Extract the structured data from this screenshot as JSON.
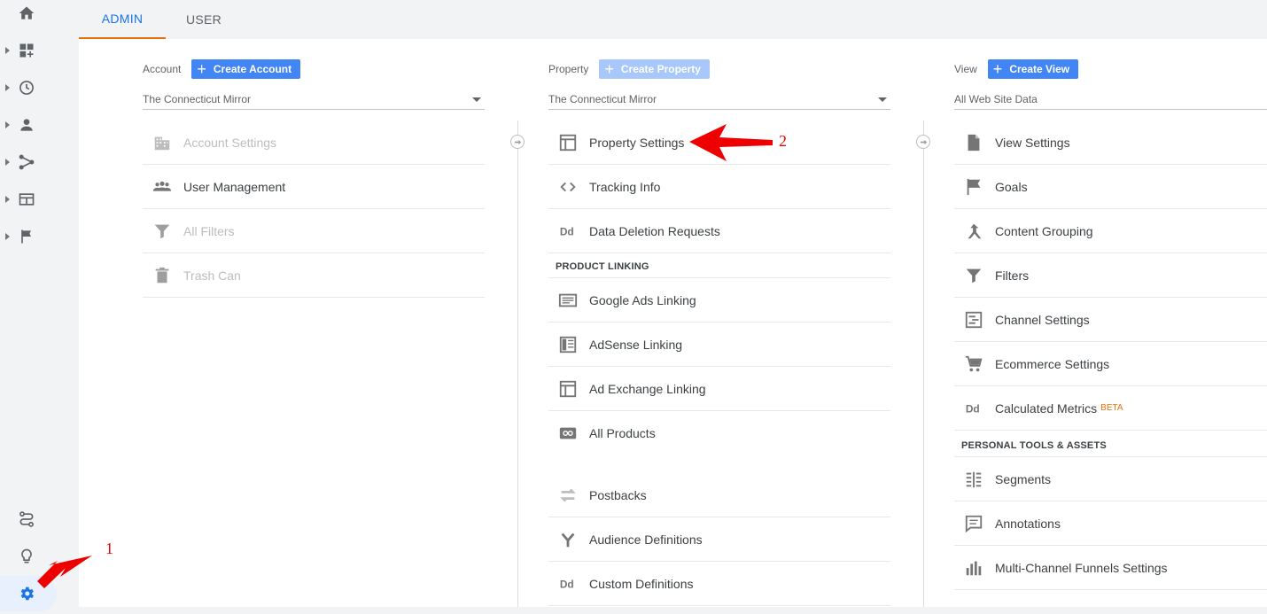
{
  "tabs": [
    "ADMIN",
    "USER"
  ],
  "sidenav": {
    "items": [
      {
        "icon": "home-icon"
      },
      {
        "icon": "dashboard-add-icon"
      },
      {
        "icon": "clock-icon"
      },
      {
        "icon": "person-icon"
      },
      {
        "icon": "acquisition-icon"
      },
      {
        "icon": "behavior-icon"
      },
      {
        "icon": "flag-icon"
      },
      {
        "icon": "route-icon"
      },
      {
        "icon": "lightbulb-icon"
      },
      {
        "icon": "gear-icon"
      }
    ]
  },
  "account": {
    "label": "Account",
    "create_label": "Create Account",
    "selected": "The Connecticut Mirror",
    "items": [
      {
        "label": "Account Settings",
        "icon": "building-icon",
        "dim": true
      },
      {
        "label": "User Management",
        "icon": "people-icon",
        "dim": false
      },
      {
        "label": "All Filters",
        "icon": "filter-icon",
        "dim": true
      },
      {
        "label": "Trash Can",
        "icon": "trash-icon",
        "dim": true
      }
    ]
  },
  "property": {
    "label": "Property",
    "create_label": "Create Property",
    "selected": "The Connecticut Mirror",
    "items": [
      {
        "label": "Property Settings",
        "icon": "window-icon"
      },
      {
        "label": "Tracking Info",
        "icon": "code-icon"
      },
      {
        "label": "Data Deletion Requests",
        "icon": "dd-icon"
      }
    ],
    "section": "PRODUCT LINKING",
    "linking": [
      {
        "label": "Google Ads Linking",
        "icon": "ads-icon"
      },
      {
        "label": "AdSense Linking",
        "icon": "adsense-icon"
      },
      {
        "label": "Ad Exchange Linking",
        "icon": "window-icon"
      },
      {
        "label": "All Products",
        "icon": "link-icon"
      },
      {
        "label": "Postbacks",
        "icon": "swap-icon"
      },
      {
        "label": "Audience Definitions",
        "icon": "fork-icon"
      },
      {
        "label": "Custom Definitions",
        "icon": "dd-icon"
      }
    ]
  },
  "view": {
    "label": "View",
    "create_label": "Create View",
    "selected": "All Web Site Data",
    "items": [
      {
        "label": "View Settings",
        "icon": "document-icon"
      },
      {
        "label": "Goals",
        "icon": "flag-icon"
      },
      {
        "label": "Content Grouping",
        "icon": "merge-icon"
      },
      {
        "label": "Filters",
        "icon": "filter-icon"
      },
      {
        "label": "Channel Settings",
        "icon": "channel-icon"
      },
      {
        "label": "Ecommerce Settings",
        "icon": "cart-icon"
      },
      {
        "label": "Calculated Metrics",
        "icon": "dd-icon",
        "badge": "BETA"
      }
    ],
    "section": "PERSONAL TOOLS & ASSETS",
    "tools": [
      {
        "label": "Segments",
        "icon": "segments-icon"
      },
      {
        "label": "Annotations",
        "icon": "comment-icon"
      },
      {
        "label": "Multi-Channel Funnels Settings",
        "icon": "bars-icon"
      }
    ]
  },
  "annotations": {
    "one": "1",
    "two": "2"
  },
  "colors": {
    "accent": "#1a73e8",
    "tab_underline": "#e8710a",
    "button": "#4285f4",
    "annotation": "#ee0000"
  }
}
